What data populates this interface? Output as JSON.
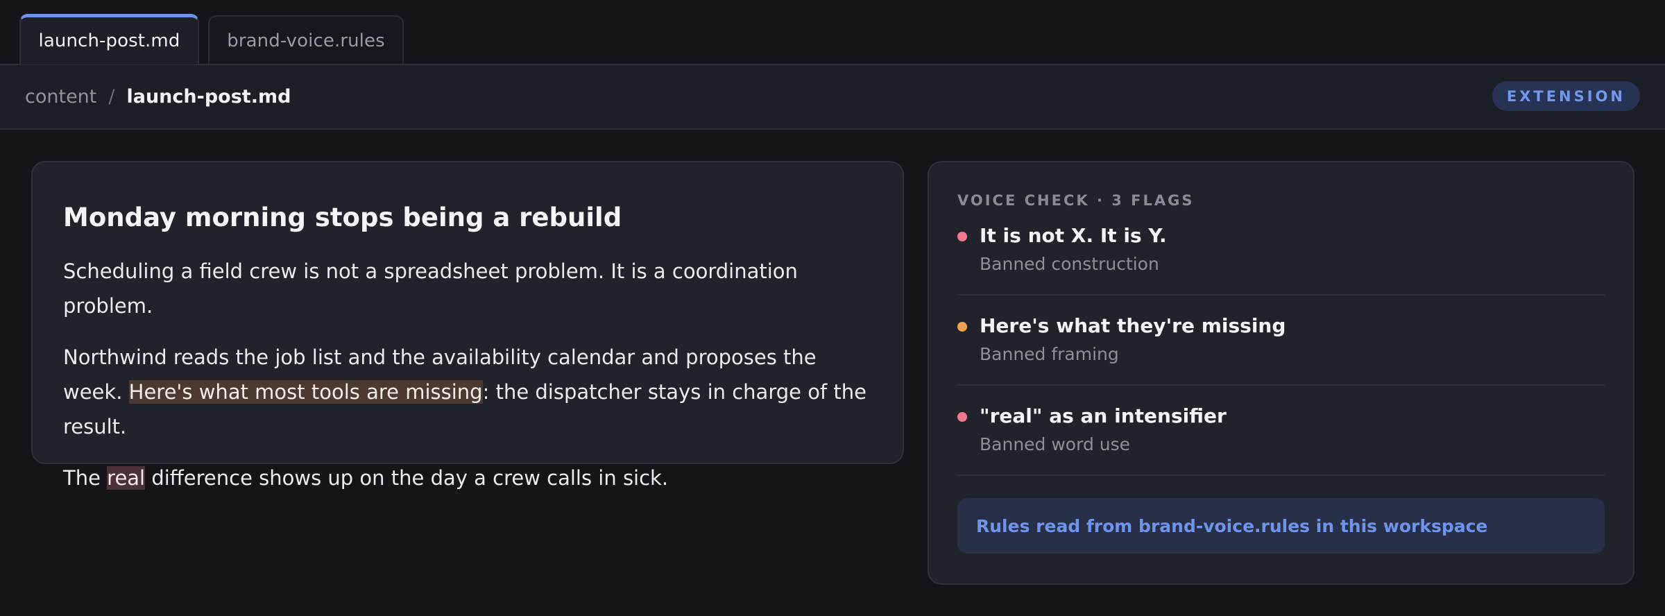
{
  "tabs": [
    {
      "label": "launch-post.md",
      "active": true
    },
    {
      "label": "brand-voice.rules",
      "active": false
    }
  ],
  "breadcrumb": {
    "root": "content",
    "separator": "/",
    "current": "launch-post.md"
  },
  "badge": {
    "label": "EXTENSION"
  },
  "document": {
    "title": "Monday morning stops being a rebuild",
    "para1": "Scheduling a field crew is not a spreadsheet problem. It is a coordination problem.",
    "para2_before": "Northwind reads the job list and the availability calendar and proposes the week. ",
    "para2_highlight": "Here's what most tools are missing",
    "para2_after": ": the dispatcher stays in charge of the result.",
    "para3_before": "The ",
    "para3_highlight": "real",
    "para3_after": " difference shows up on the day a crew calls in sick."
  },
  "voice_check": {
    "heading": "VOICE CHECK · 3 FLAGS",
    "flags": [
      {
        "title": "It is not X. It is Y.",
        "category": "Banned construction",
        "color": "#f0788c"
      },
      {
        "title": "Here's what they're missing",
        "category": "Banned framing",
        "color": "#f0a24e"
      },
      {
        "title": "\"real\" as an intensifier",
        "category": "Banned word use",
        "color": "#f0788c"
      }
    ],
    "rules_note": "Rules read from brand-voice.rules in this workspace"
  },
  "colors": {
    "accent": "#6f93ec",
    "background": "#141419",
    "card": "#22222b",
    "highlight_framing": "#4a3a31",
    "highlight_word": "#4a3038"
  }
}
